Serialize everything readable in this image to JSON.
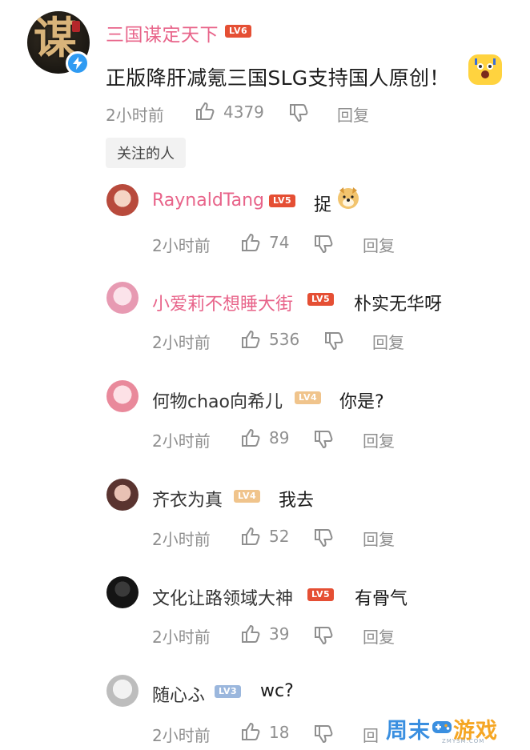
{
  "main_comment": {
    "avatar_icon": "calligraphy-avatar",
    "verified_icon": "verified-lightning-icon",
    "username": "三国谋定天下",
    "level": "LV6",
    "text": "正版降肝减氪三国SLG支持国人原创！",
    "emoji_icon": "shocked-face-emoji",
    "time": "2小时前",
    "likes": "4379",
    "reply_label": "回复"
  },
  "tag_chip": "关注的人",
  "replies": [
    {
      "username": "RaynaldTang",
      "level": "LV5",
      "text": "捉",
      "emoji_icon": "doge-emoji",
      "time": "2小时前",
      "likes": "74",
      "reply_label": "回复",
      "name_color": "#e8648a"
    },
    {
      "username": "小爱莉不想睡大街",
      "level": "LV5",
      "text": "朴实无华呀",
      "time": "2小时前",
      "likes": "536",
      "reply_label": "回复",
      "name_color": "#e8648a"
    },
    {
      "username": "何物chao向希儿",
      "level": "LV4",
      "text": "你是?",
      "time": "2小时前",
      "likes": "89",
      "reply_label": "回复",
      "name_color": "#333333"
    },
    {
      "username": "齐衣为真",
      "level": "LV4",
      "text": "我去",
      "time": "2小时前",
      "likes": "52",
      "reply_label": "回复",
      "name_color": "#333333"
    },
    {
      "username": "文化让路领域大神",
      "level": "LV5",
      "text": "有骨气",
      "time": "2小时前",
      "likes": "39",
      "reply_label": "回复",
      "name_color": "#333333"
    },
    {
      "username": "随心ふ",
      "level": "LV3",
      "text": "wc?",
      "time": "2小时前",
      "likes": "18",
      "reply_label": "回",
      "name_color": "#333333"
    }
  ],
  "watermark": {
    "part1": "周末",
    "part2": "游戏",
    "sub": "ZMYSM.COM"
  },
  "colors": {
    "pink_name": "#e8648a",
    "level_red": "#e54f34",
    "level_orange": "#f0c48c",
    "level_blue": "#9bb7dd",
    "meta_gray": "#8f8f8f"
  }
}
